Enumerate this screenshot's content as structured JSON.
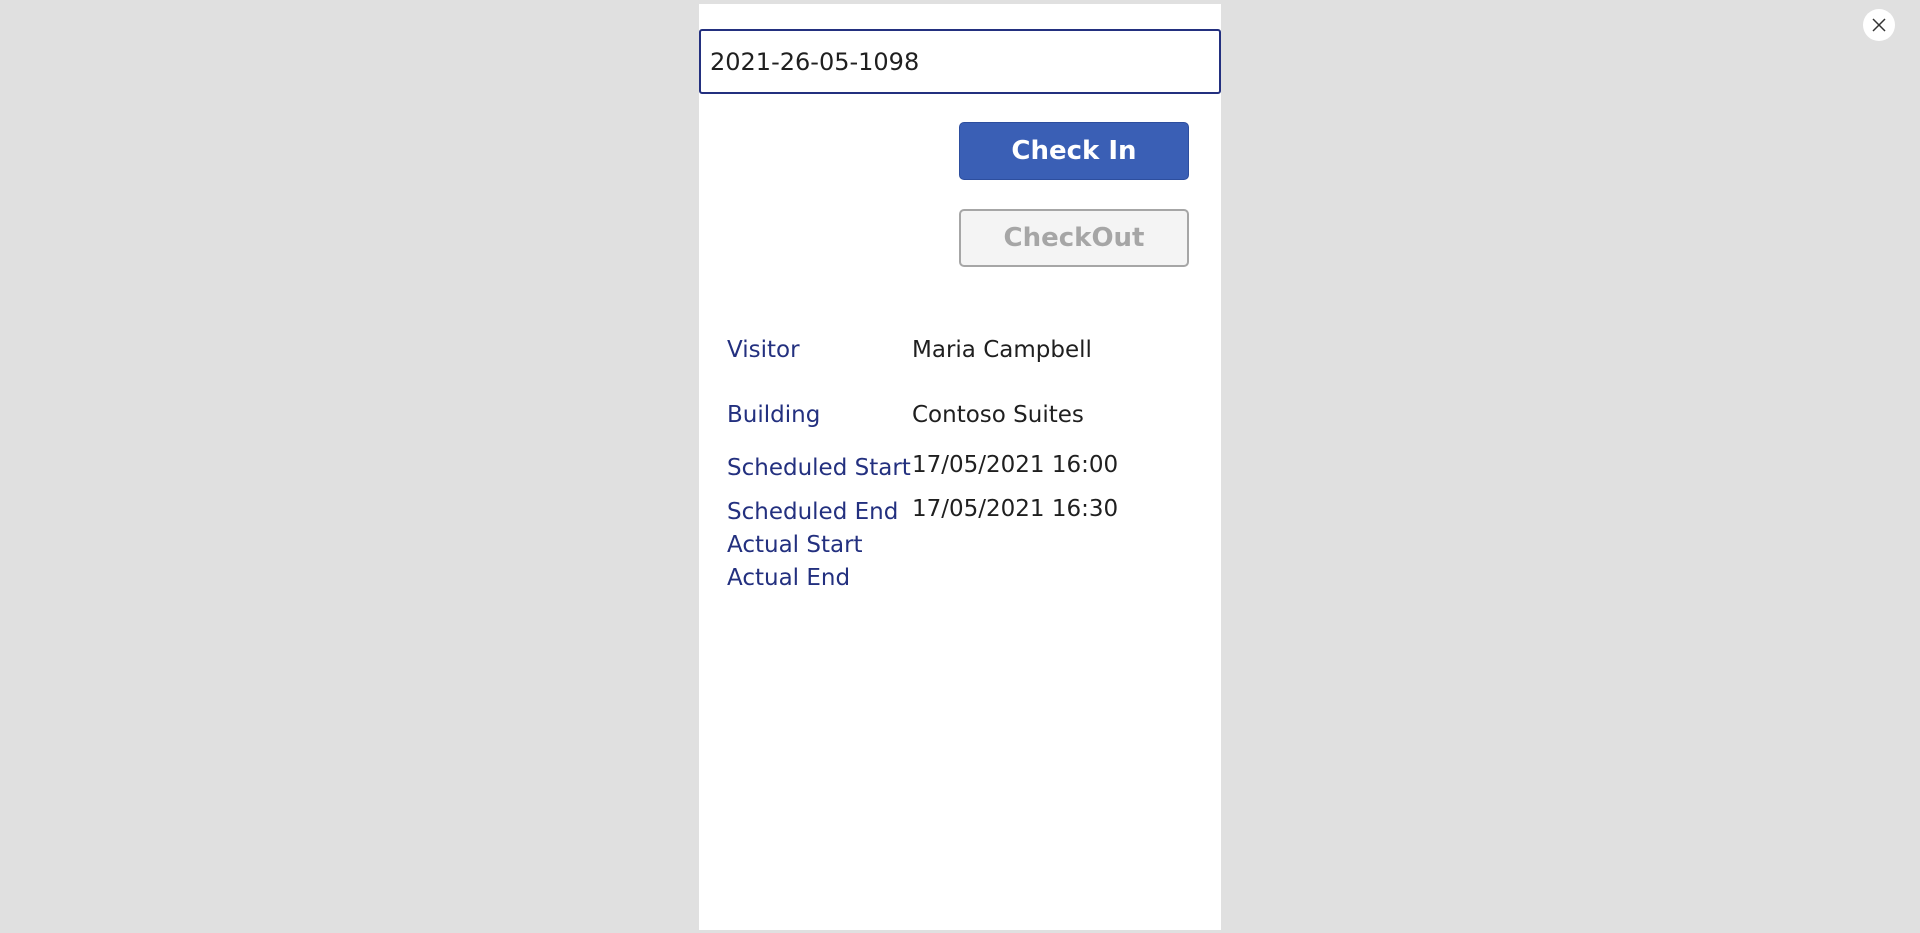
{
  "close_button": {
    "icon": "close-icon"
  },
  "visit_code": {
    "value": "2021-26-05-1098"
  },
  "actions": {
    "check_in_label": "Check In",
    "check_out_label": "CheckOut"
  },
  "details": {
    "visitor_label": "Visitor",
    "visitor_value": "Maria Campbell",
    "building_label": "Building",
    "building_value": "Contoso Suites",
    "scheduled_start_label": "Scheduled Start",
    "scheduled_start_value": "17/05/2021 16:00",
    "scheduled_end_label": "Scheduled End",
    "scheduled_end_value": "17/05/2021 16:30",
    "actual_start_label": "Actual Start",
    "actual_end_label": "Actual End"
  },
  "colors": {
    "background": "#e0e0e0",
    "panel": "#ffffff",
    "accent": "#3a5fb5",
    "label": "#23307f",
    "disabled": "#a6a6a6"
  }
}
